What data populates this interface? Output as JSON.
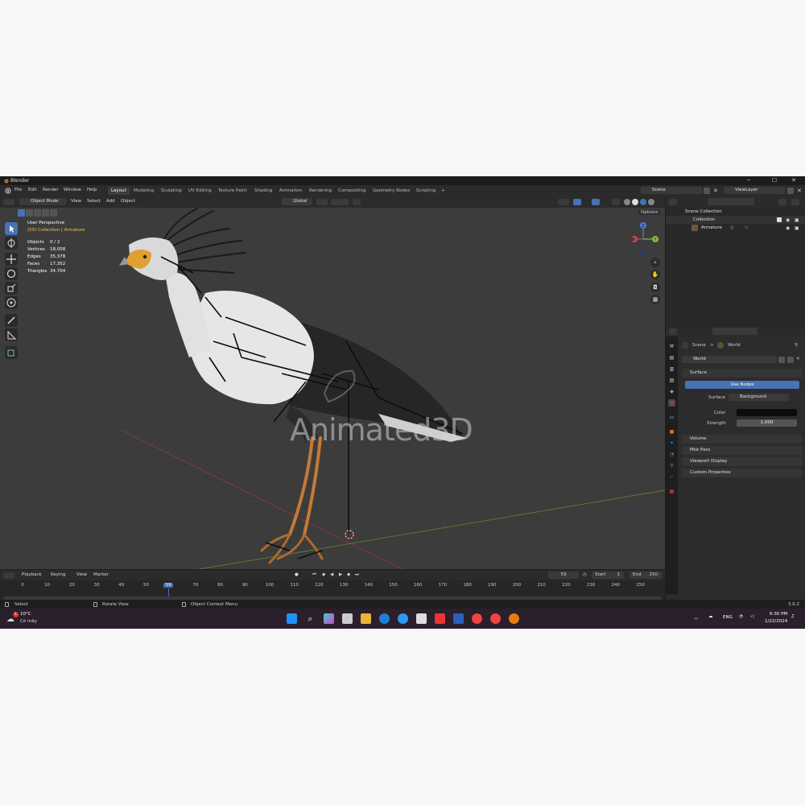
{
  "window": {
    "app_title": "Blender",
    "minimize": "─",
    "maximize": "☐",
    "close": "✕"
  },
  "menu": {
    "items": [
      "File",
      "Edit",
      "Render",
      "Window",
      "Help"
    ],
    "workspaces": [
      "Layout",
      "Modeling",
      "Sculpting",
      "UV Editing",
      "Texture Paint",
      "Shading",
      "Animation",
      "Rendering",
      "Compositing",
      "Geometry Nodes",
      "Scripting"
    ],
    "add_workspace": "+",
    "scene_label": "Scene",
    "viewlayer_label": "ViewLayer"
  },
  "viewport_header": {
    "mode": "Object Mode",
    "menus": [
      "View",
      "Select",
      "Add",
      "Object"
    ],
    "orientation": "Global",
    "options": "Options"
  },
  "viewport_overlay": {
    "view_name": "User Perspective",
    "collection_info": "(59) Collection | Armature",
    "stats": [
      {
        "label": "Objects",
        "value": "0 / 2"
      },
      {
        "label": "Vertices",
        "value": "18,058"
      },
      {
        "label": "Edges",
        "value": "35,378"
      },
      {
        "label": "Faces",
        "value": "17,352"
      },
      {
        "label": "Triangles",
        "value": "34,704"
      }
    ],
    "watermark": "Animated3D",
    "gizmo": {
      "x": "X",
      "y": "Y",
      "z": "Z"
    }
  },
  "outliner": {
    "root": "Scene Collection",
    "collection": "Collection",
    "armature": "Armature"
  },
  "properties": {
    "breadcrumb_scene": "Scene",
    "breadcrumb_sep": ">",
    "breadcrumb_world": "World",
    "world_name": "World",
    "surface_panel": "Surface",
    "use_nodes": "Use Nodes",
    "surface_label": "Surface",
    "surface_value": "Background",
    "color_label": "Color",
    "strength_label": "Strength",
    "strength_value": "1.000",
    "world_color": "#0c0c0c",
    "collapsed_panels": [
      "Volume",
      "Mist Pass",
      "Viewport Display",
      "Custom Properties"
    ]
  },
  "timeline": {
    "menus": [
      "Playback",
      "Keying",
      "View",
      "Marker"
    ],
    "current_frame": "59",
    "start_label": "Start",
    "start_value": "1",
    "end_label": "End",
    "end_value": "250",
    "ticks": [
      "0",
      "10",
      "20",
      "30",
      "40",
      "50",
      "59",
      "70",
      "80",
      "90",
      "100",
      "110",
      "120",
      "130",
      "140",
      "150",
      "160",
      "170",
      "180",
      "190",
      "200",
      "210",
      "220",
      "230",
      "240",
      "250"
    ]
  },
  "statusbar": {
    "select": "Select",
    "rotate": "Rotate View",
    "context": "Object Context Menu",
    "version": "3.6.2"
  },
  "taskbar": {
    "weather_temp": "10°C",
    "weather_desc": "Có mây",
    "weather_badge": "1",
    "lang": "ENG",
    "time": "6:30 PM",
    "date": "1/22/2024"
  },
  "colors": {
    "accent": "#4772b3",
    "frame_marker": "#4772b3",
    "x_axis": "#c64e54",
    "y_axis": "#7fbf3f",
    "z_axis": "#4f7bd9"
  }
}
